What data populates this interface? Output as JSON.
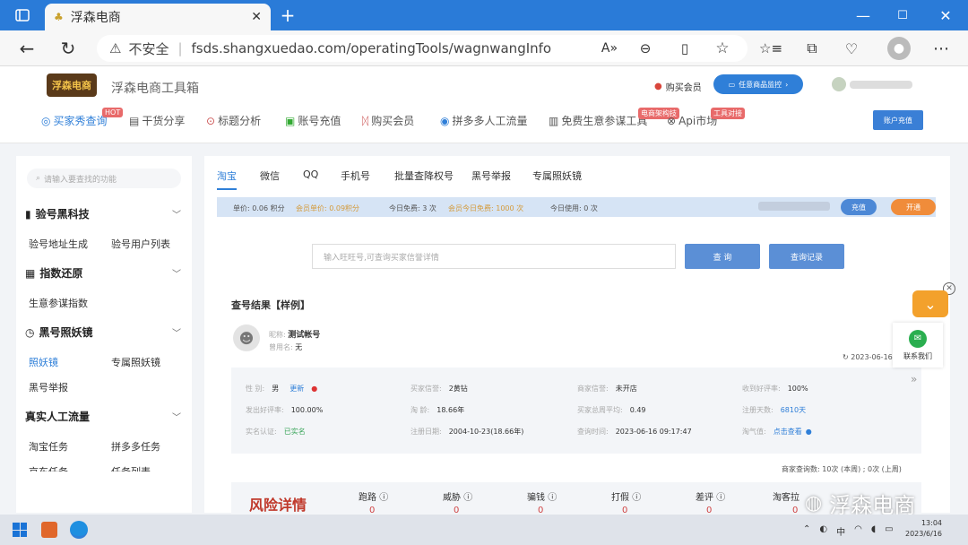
{
  "browser": {
    "tab_title": "浮森电商",
    "security_label": "不安全",
    "url": "fsds.shangxuedao.com/operatingTools/wagnwangInfo"
  },
  "site": {
    "logo_text": "浮森电商",
    "title": "浮森电商工具箱",
    "buy_member": "购买会员",
    "monitor_btn": "任意商品监控",
    "account_topup": "账户充值",
    "nav": [
      {
        "label": "买家秀查询",
        "badge": "HOT"
      },
      {
        "label": "干货分享"
      },
      {
        "label": "标题分析"
      },
      {
        "label": "账号充值"
      },
      {
        "label": "购买会员"
      },
      {
        "label": "拼多多人工流量"
      },
      {
        "label": "免费生意参谋工具",
        "badge": "电商架构技"
      },
      {
        "label": "Api市场",
        "badge": "工具对接"
      }
    ]
  },
  "sidebar": {
    "search_placeholder": "请输入要查找的功能",
    "sections": [
      {
        "title": "验号黑科技",
        "items": [
          "验号地址生成",
          "验号用户列表"
        ]
      },
      {
        "title": "指数还原",
        "items": [
          "生意参谋指数"
        ]
      },
      {
        "title": "黑号照妖镜",
        "items": [
          "照妖镜",
          "专属照妖镜",
          "黑号举报"
        ]
      },
      {
        "title": "真实人工流量",
        "items": [
          "淘宝任务",
          "拼多多任务",
          "京东任务",
          "任务列表"
        ]
      }
    ]
  },
  "main": {
    "tabs": [
      "淘宝",
      "微信",
      "QQ",
      "手机号",
      "批量查降权号",
      "黑号举报",
      "专属照妖镜"
    ],
    "info": {
      "price": "单价: 0.06 积分",
      "member_price": "会员单价: 0.09积分",
      "free_today": "今日免费: 3 次",
      "member_free": "会员今日免费: 1000 次",
      "used_today": "今日使用: 0 次",
      "recharge": "充值",
      "upgrade": "开通"
    },
    "input_placeholder": "输入旺旺号,可查询买家信誉详情",
    "query_btn": "查 询",
    "history_btn": "查询记录",
    "result_title": "查号结果【样例】",
    "nickname_label": "昵称:",
    "nickname": "测试帐号",
    "used_name_label": "曾用名:",
    "used_name": "无",
    "date": "2023-06-16",
    "details": [
      {
        "k": "性 别:",
        "v": "男",
        "extra": "更新"
      },
      {
        "k": "买家信誉:",
        "v": "2黄钻"
      },
      {
        "k": "商家信誉:",
        "v": "未开店"
      },
      {
        "k": "收到好评率:",
        "v": "100%"
      },
      {
        "k": "发出好评率:",
        "v": "100.00%"
      },
      {
        "k": "淘 龄:",
        "v": "18.66年"
      },
      {
        "k": "买家总周平均:",
        "v": "0.49"
      },
      {
        "k": "注册天数:",
        "v": "6810天"
      },
      {
        "k": "实名认证:",
        "v": "已实名"
      },
      {
        "k": "注册日期:",
        "v": "2004-10-23(18.66年)"
      },
      {
        "k": "查询时间:",
        "v": "2023-06-16 09:17:47"
      },
      {
        "k": "淘气值:",
        "v": "点击查看"
      }
    ],
    "shop_queries": "商家查询数: 10次 (本周) ; 0次 (上周)",
    "risk_title": "风险详情",
    "risk": [
      {
        "k": "跑路",
        "v": "0"
      },
      {
        "k": "威胁",
        "v": "0"
      },
      {
        "k": "骗钱",
        "v": "0"
      },
      {
        "k": "打假",
        "v": "0"
      },
      {
        "k": "差评",
        "v": "0"
      },
      {
        "k": "淘客拉",
        "v": "0"
      }
    ]
  },
  "float": {
    "contact": "联系我们"
  },
  "watermark": "浮森电商",
  "taskbar": {
    "time": "13:04",
    "date": "2023/6/16",
    "ime": "中"
  }
}
